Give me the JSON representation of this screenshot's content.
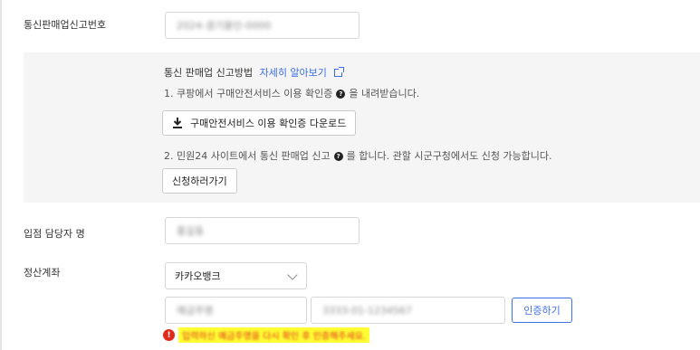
{
  "form": {
    "telecom_sales_report_number": {
      "label": "통신판매업신고번호",
      "value": "2024-경기용인-0000"
    },
    "guide": {
      "title": "통신 판매업 신고방법",
      "link_label": "자세히 알아보기",
      "step1": "1. 쿠팡에서 구매안전서비스 이용 확인증",
      "step1_suffix": "을 내려받습니다.",
      "download_button_label": "구매안전서비스 이용 확인증 다운로드",
      "step2": "2. 민원24 사이트에서 통신 판매업 신고",
      "step2_suffix": "를 합니다. 관할 시군구청에서도 신청 가능합니다.",
      "apply_button_label": "신청하러가기"
    },
    "manager_name": {
      "label": "입점 담당자 명",
      "value": "홍길동"
    },
    "settlement_account": {
      "label": "정산계좌",
      "bank_selected": "카카오뱅크",
      "account_holder_value": "예금주명",
      "account_number_value": "3333-01-1234567",
      "verify_button_label": "인증하기",
      "error_message": "입력하신 예금주명을 다시 확인 후 인증해주세요."
    }
  },
  "colors": {
    "link_blue": "#3d6ee9",
    "error_red": "#e02a1c",
    "highlight_yellow": "#ffff33",
    "guide_bg": "#f5f5f5"
  },
  "icons": {
    "external_link": "external-link-icon",
    "help": "question-icon",
    "download": "download-icon",
    "chevron": "chevron-down-icon",
    "error": "error-icon"
  }
}
